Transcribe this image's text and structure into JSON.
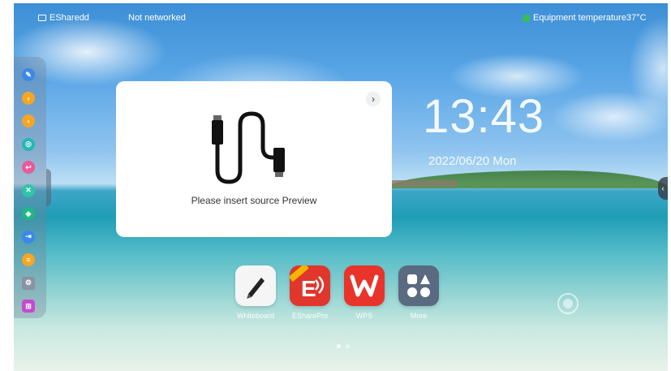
{
  "status": {
    "network_name": "ESharedd",
    "network_status": "Not networked",
    "temperature": "Equipment temperature37°C"
  },
  "dock": {
    "items": [
      {
        "icon": "pen-icon",
        "color": "#3a88e8",
        "glyph": "✎"
      },
      {
        "icon": "arrow-right-icon",
        "color": "#f5a623",
        "glyph": "›"
      },
      {
        "icon": "arrow-left-icon",
        "color": "#f5a623",
        "glyph": "‹"
      },
      {
        "icon": "target-icon",
        "color": "#24b8b0",
        "glyph": "◎"
      },
      {
        "icon": "back-icon",
        "color": "#e85a9a",
        "glyph": "↩"
      },
      {
        "icon": "eraser-icon",
        "color": "#2fc4a8",
        "glyph": "✕"
      },
      {
        "icon": "layers-icon",
        "color": "#1fb884",
        "glyph": "◈"
      },
      {
        "icon": "input-icon",
        "color": "#3a88e8",
        "glyph": "⇥"
      },
      {
        "icon": "list-icon",
        "color": "#f5a623",
        "glyph": "≡"
      },
      {
        "icon": "gear-icon",
        "color": "#8a93a0",
        "glyph": "⚙"
      },
      {
        "icon": "apps-icon",
        "color": "#c44ad0",
        "glyph": "⊞"
      }
    ]
  },
  "preview": {
    "message": "Please insert source Preview"
  },
  "clock": {
    "time": "13:43",
    "date": "2022/06/20 Mon"
  },
  "apps": [
    {
      "label": "Whiteboard",
      "icon": "whiteboard-icon"
    },
    {
      "label": "ESharePro",
      "icon": "esharepro-icon"
    },
    {
      "label": "WPS",
      "icon": "wps-icon"
    },
    {
      "label": "More",
      "icon": "more-apps-icon"
    }
  ],
  "pager": {
    "total": 2,
    "active": 1
  }
}
